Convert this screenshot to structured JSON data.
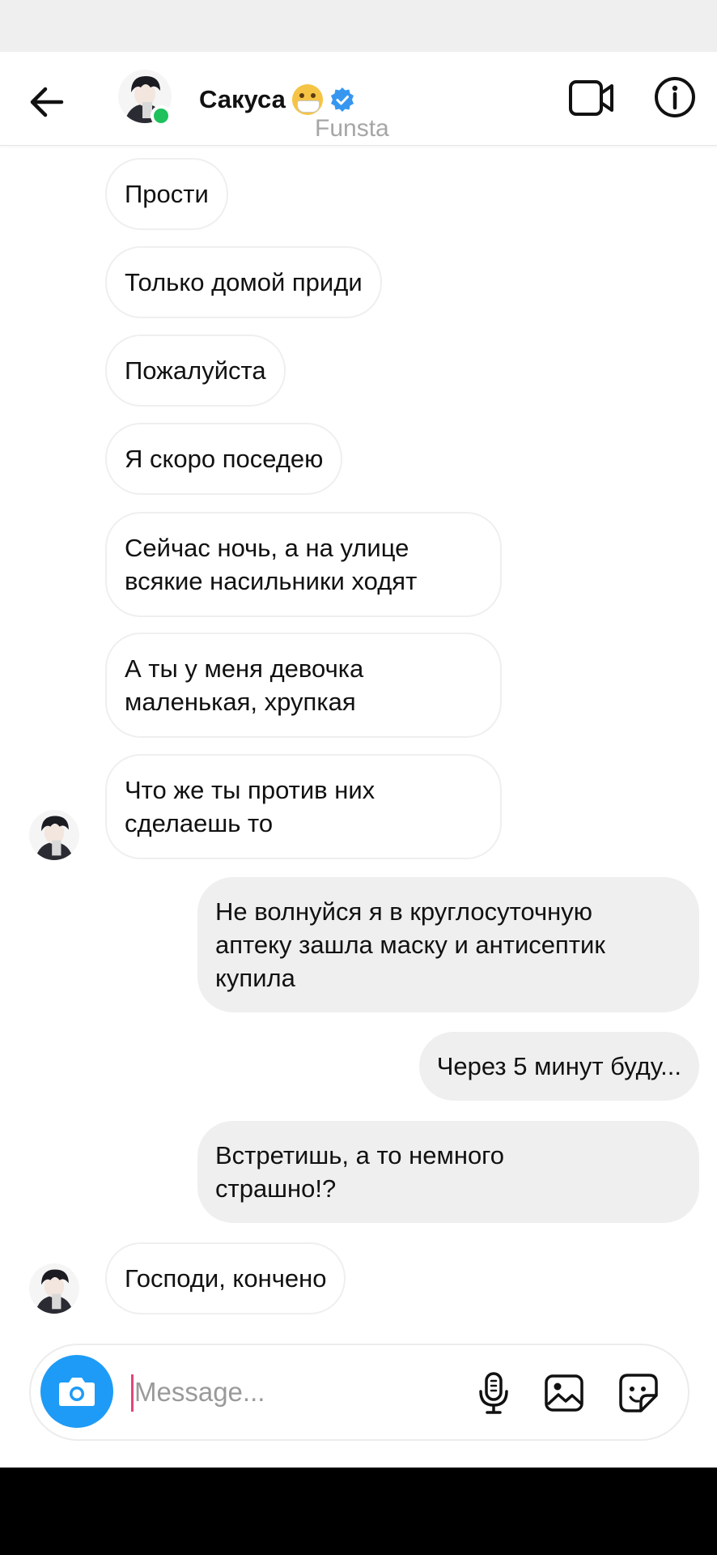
{
  "header": {
    "contact_name": "Сакуса",
    "subtitle": "Funsta",
    "back_icon": "arrow-left-icon",
    "video_icon": "video-call-icon",
    "info_icon": "info-icon",
    "online_color": "#1ec15b",
    "verified_color": "#3797f0"
  },
  "messages": [
    {
      "side": "in",
      "text": "Прости"
    },
    {
      "side": "in",
      "text": "Только домой приди"
    },
    {
      "side": "in",
      "text": "Пожалуйста"
    },
    {
      "side": "in",
      "text": "Я скоро поседею"
    },
    {
      "side": "in",
      "text": "Сейчас ночь, а на улице\nвсякие насильники ходят"
    },
    {
      "side": "in",
      "text": "А ты у меня девочка\nмаленькая, хрупкая"
    },
    {
      "side": "in",
      "text": "Что же ты против них\nсделаешь то"
    },
    {
      "side": "out",
      "text": "Не волнуйся я в круглосуточную\nаптеку зашла маску и антисептик\nкупила"
    },
    {
      "side": "out",
      "text": "Через 5 минут буду..."
    },
    {
      "side": "out",
      "text": "Встретишь, а то немного\nстрашно!?"
    },
    {
      "side": "in",
      "text": "Господи, кончено"
    }
  ],
  "composer": {
    "placeholder": "Message...",
    "value": "",
    "camera_icon": "camera-icon",
    "mic_icon": "microphone-icon",
    "gallery_icon": "image-gallery-icon",
    "sticker_icon": "sticker-icon",
    "accent_color": "#1e9bf6"
  }
}
